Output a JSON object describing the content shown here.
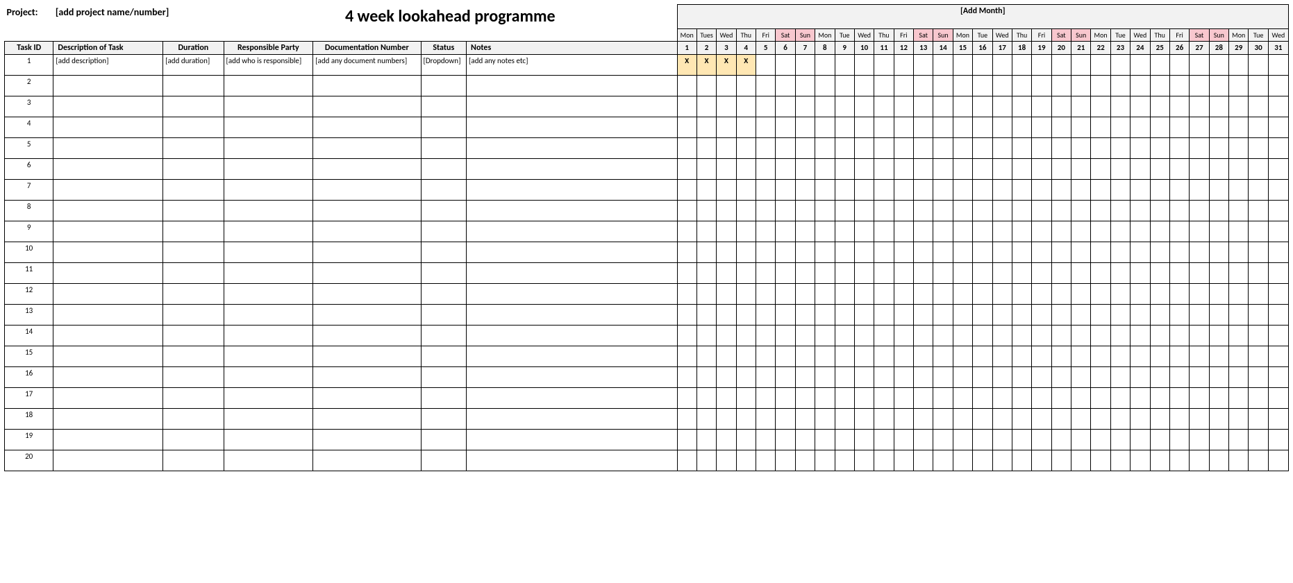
{
  "header": {
    "project_label": "Project:",
    "project_value": "[add project name/number]",
    "title": "4 week lookahead programme",
    "month_label": "[Add Month]"
  },
  "columns": {
    "task_id": "Task ID",
    "description": "Description of Task",
    "duration": "Duration",
    "responsible": "Responsible Party",
    "doc_number": "Documentation Number",
    "status": "Status",
    "notes": "Notes"
  },
  "days": [
    {
      "dow": "Mon",
      "num": "1",
      "weekend": false
    },
    {
      "dow": "Tues",
      "num": "2",
      "weekend": false
    },
    {
      "dow": "Wed",
      "num": "3",
      "weekend": false
    },
    {
      "dow": "Thu",
      "num": "4",
      "weekend": false
    },
    {
      "dow": "Fri",
      "num": "5",
      "weekend": false
    },
    {
      "dow": "Sat",
      "num": "6",
      "weekend": true
    },
    {
      "dow": "Sun",
      "num": "7",
      "weekend": true
    },
    {
      "dow": "Mon",
      "num": "8",
      "weekend": false
    },
    {
      "dow": "Tue",
      "num": "9",
      "weekend": false
    },
    {
      "dow": "Wed",
      "num": "10",
      "weekend": false
    },
    {
      "dow": "Thu",
      "num": "11",
      "weekend": false
    },
    {
      "dow": "Fri",
      "num": "12",
      "weekend": false
    },
    {
      "dow": "Sat",
      "num": "13",
      "weekend": true
    },
    {
      "dow": "Sun",
      "num": "14",
      "weekend": true
    },
    {
      "dow": "Mon",
      "num": "15",
      "weekend": false
    },
    {
      "dow": "Tue",
      "num": "16",
      "weekend": false
    },
    {
      "dow": "Wed",
      "num": "17",
      "weekend": false
    },
    {
      "dow": "Thu",
      "num": "18",
      "weekend": false
    },
    {
      "dow": "Fri",
      "num": "19",
      "weekend": false
    },
    {
      "dow": "Sat",
      "num": "20",
      "weekend": true
    },
    {
      "dow": "Sun",
      "num": "21",
      "weekend": true
    },
    {
      "dow": "Mon",
      "num": "22",
      "weekend": false
    },
    {
      "dow": "Tue",
      "num": "23",
      "weekend": false
    },
    {
      "dow": "Wed",
      "num": "24",
      "weekend": false
    },
    {
      "dow": "Thu",
      "num": "25",
      "weekend": false
    },
    {
      "dow": "Fri",
      "num": "26",
      "weekend": false
    },
    {
      "dow": "Sat",
      "num": "27",
      "weekend": true
    },
    {
      "dow": "Sun",
      "num": "28",
      "weekend": true
    },
    {
      "dow": "Mon",
      "num": "29",
      "weekend": false
    },
    {
      "dow": "Tue",
      "num": "30",
      "weekend": false
    },
    {
      "dow": "Wed",
      "num": "31",
      "weekend": false
    }
  ],
  "rows": [
    {
      "id": "1",
      "description": "[add description]",
      "duration": "[add duration]",
      "responsible": "[add who is responsible]",
      "doc_number": "[add any document numbers]",
      "status": "[Dropdown]",
      "notes": "[add any notes etc]",
      "gantt": [
        true,
        true,
        true,
        true,
        false,
        false,
        false,
        false,
        false,
        false,
        false,
        false,
        false,
        false,
        false,
        false,
        false,
        false,
        false,
        false,
        false,
        false,
        false,
        false,
        false,
        false,
        false,
        false,
        false,
        false,
        false
      ]
    },
    {
      "id": "2"
    },
    {
      "id": "3"
    },
    {
      "id": "4"
    },
    {
      "id": "5"
    },
    {
      "id": "6"
    },
    {
      "id": "7"
    },
    {
      "id": "8"
    },
    {
      "id": "9"
    },
    {
      "id": "10"
    },
    {
      "id": "11"
    },
    {
      "id": "12"
    },
    {
      "id": "13"
    },
    {
      "id": "14"
    },
    {
      "id": "15"
    },
    {
      "id": "16"
    },
    {
      "id": "17"
    },
    {
      "id": "18"
    },
    {
      "id": "19"
    },
    {
      "id": "20"
    }
  ],
  "gantt_mark": "X"
}
